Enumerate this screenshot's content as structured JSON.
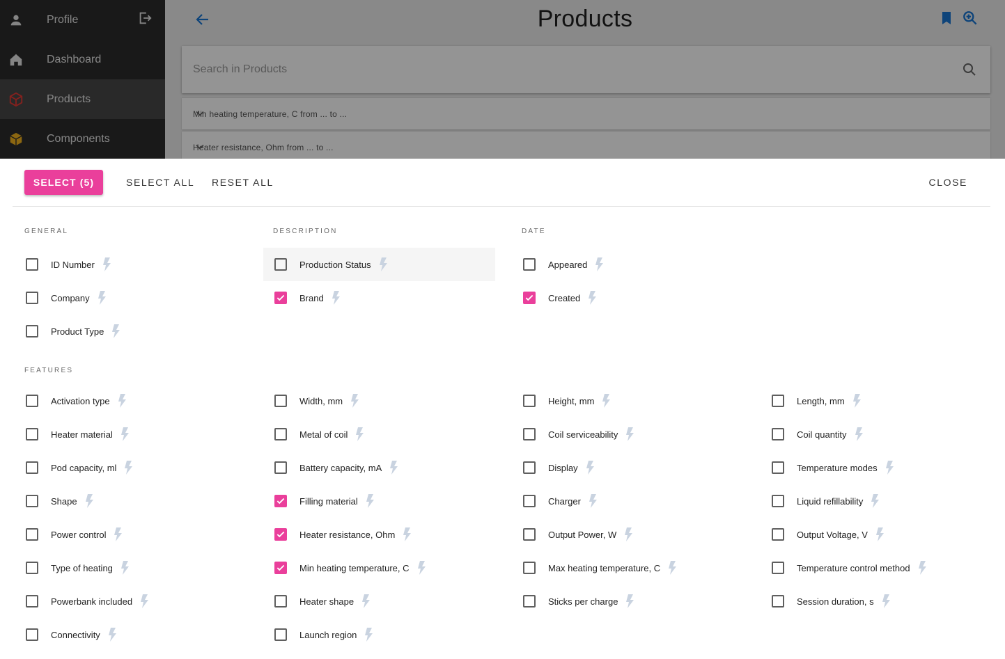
{
  "nav": {
    "items": [
      {
        "label": "Profile",
        "icon": "person-icon"
      },
      {
        "label": "Dashboard",
        "icon": "home-icon"
      },
      {
        "label": "Products",
        "icon": "box-icon",
        "active": true
      },
      {
        "label": "Components",
        "icon": "box-filled-icon"
      }
    ]
  },
  "header": {
    "title": "Products"
  },
  "search": {
    "placeholder": "Search in Products"
  },
  "filters": [
    "Min heating temperature, C from ... to ...",
    "Heater resistance, Ohm from ... to ..."
  ],
  "actions": {
    "select": "SELECT (5)",
    "select_all": "SELECT ALL",
    "reset_all": "RESET ALL",
    "close": "CLOSE"
  },
  "colors": {
    "accent": "#ea3f9b",
    "sidebar": "#2b2b2b",
    "link": "#1976d2",
    "bolt": "#c9d3e0"
  },
  "sections": {
    "general": {
      "title": "GENERAL",
      "options": [
        {
          "label": "ID Number",
          "checked": false
        },
        {
          "label": "Company",
          "checked": false
        },
        {
          "label": "Product Type",
          "checked": false
        }
      ]
    },
    "description": {
      "title": "DESCRIPTION",
      "options": [
        {
          "label": "Production Status",
          "checked": false,
          "highlighted": true
        },
        {
          "label": "Brand",
          "checked": true
        }
      ]
    },
    "date": {
      "title": "DATE",
      "options": [
        {
          "label": "Appeared",
          "checked": false
        },
        {
          "label": "Created",
          "checked": true
        }
      ]
    },
    "features": {
      "title": "FEATURES",
      "columns": [
        [
          {
            "label": "Activation type",
            "checked": false
          },
          {
            "label": "Heater material",
            "checked": false
          },
          {
            "label": "Pod capacity, ml",
            "checked": false
          },
          {
            "label": "Shape",
            "checked": false
          },
          {
            "label": "Power control",
            "checked": false
          },
          {
            "label": "Type of heating",
            "checked": false
          },
          {
            "label": "Powerbank included",
            "checked": false
          },
          {
            "label": "Connectivity",
            "checked": false
          }
        ],
        [
          {
            "label": "Width, mm",
            "checked": false
          },
          {
            "label": "Metal of coil",
            "checked": false
          },
          {
            "label": "Battery capacity, mA",
            "checked": false
          },
          {
            "label": "Filling material",
            "checked": true
          },
          {
            "label": "Heater resistance, Ohm",
            "checked": true
          },
          {
            "label": "Min heating temperature, C",
            "checked": true
          },
          {
            "label": "Heater shape",
            "checked": false
          },
          {
            "label": "Launch region",
            "checked": false
          }
        ],
        [
          {
            "label": "Height, mm",
            "checked": false
          },
          {
            "label": "Coil serviceability",
            "checked": false
          },
          {
            "label": "Display",
            "checked": false
          },
          {
            "label": "Charger",
            "checked": false
          },
          {
            "label": "Output Power, W",
            "checked": false
          },
          {
            "label": "Max heating temperature, C",
            "checked": false
          },
          {
            "label": "Sticks per charge",
            "checked": false
          }
        ],
        [
          {
            "label": "Length, mm",
            "checked": false
          },
          {
            "label": "Coil quantity",
            "checked": false
          },
          {
            "label": "Temperature modes",
            "checked": false
          },
          {
            "label": "Liquid refillability",
            "checked": false
          },
          {
            "label": "Output Voltage, V",
            "checked": false
          },
          {
            "label": "Temperature control method",
            "checked": false
          },
          {
            "label": "Session duration, s",
            "checked": false
          }
        ]
      ]
    }
  }
}
